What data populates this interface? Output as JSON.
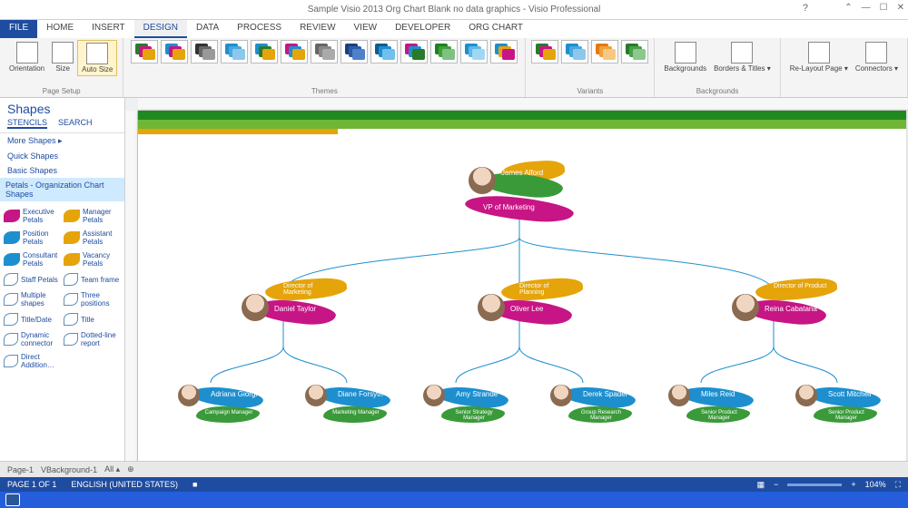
{
  "title": "Sample Visio 2013 Org Chart Blank no data graphics - Visio Professional",
  "menutabs": {
    "file": "FILE",
    "home": "HOME",
    "insert": "INSERT",
    "design": "DESIGN",
    "data": "DATA",
    "process": "PROCESS",
    "review": "REVIEW",
    "view": "VIEW",
    "developer": "DEVELOPER",
    "orgchart": "ORG CHART"
  },
  "ribbon": {
    "pagesetup": {
      "orientation": "Orientation",
      "size": "Size",
      "autosize": "Auto Size",
      "label": "Page Setup"
    },
    "themes_label": "Themes",
    "variants_label": "Variants",
    "backgrounds": "Backgrounds",
    "backgrounds_label": "Backgrounds",
    "borders": "Borders & Titles ▾",
    "relayout": "Re-Layout Page ▾",
    "connectors": "Connectors ▾"
  },
  "shapes": {
    "title": "Shapes",
    "tabs": {
      "stencils": "STENCILS",
      "search": "SEARCH"
    },
    "links": {
      "more": "More Shapes  ▸",
      "quick": "Quick Shapes",
      "basic": "Basic Shapes"
    },
    "header": "Petals - Organization Chart Shapes",
    "items": [
      {
        "label": "Executive Petals"
      },
      {
        "label": "Manager Petals"
      },
      {
        "label": "Position Petals"
      },
      {
        "label": "Assistant Petals"
      },
      {
        "label": "Consultant Petals"
      },
      {
        "label": "Vacancy Petals"
      },
      {
        "label": "Staff Petals"
      },
      {
        "label": "Team frame"
      },
      {
        "label": "Multiple shapes"
      },
      {
        "label": "Three positions"
      },
      {
        "label": "Title/Date"
      },
      {
        "label": "Title"
      },
      {
        "label": "Dynamic connector"
      },
      {
        "label": "Dotted-line report"
      },
      {
        "label": "Direct Addition…"
      }
    ]
  },
  "org": {
    "top": {
      "name": "James Alford",
      "title": "VP of Marketing"
    },
    "mgr": [
      {
        "name": "Daniel Taylor",
        "title": "Director of Marketing"
      },
      {
        "name": "Oliver Lee",
        "title": "Director of Planning"
      },
      {
        "name": "Reina Cabatana",
        "title": "Director of Product"
      }
    ],
    "leaf": [
      {
        "name": "Adriana Giorgi",
        "role": "Campaign Manager"
      },
      {
        "name": "Diane Forsyth",
        "role": "Marketing Manager"
      },
      {
        "name": "Amy Strande",
        "role": "Senior Strategy Manager"
      },
      {
        "name": "Derek Spader",
        "role": "Group Research Manager"
      },
      {
        "name": "Miles Reid",
        "role": "Senior Product Manager"
      },
      {
        "name": "Scott Mitchell",
        "role": "Senior Product Manager"
      }
    ]
  },
  "pagebar": {
    "page": "Page-1",
    "bg": "VBackground-1",
    "all": "All ▴"
  },
  "status": {
    "pages": "PAGE 1 OF 1",
    "lang": "ENGLISH (UNITED STATES)",
    "zoom": "104%"
  }
}
